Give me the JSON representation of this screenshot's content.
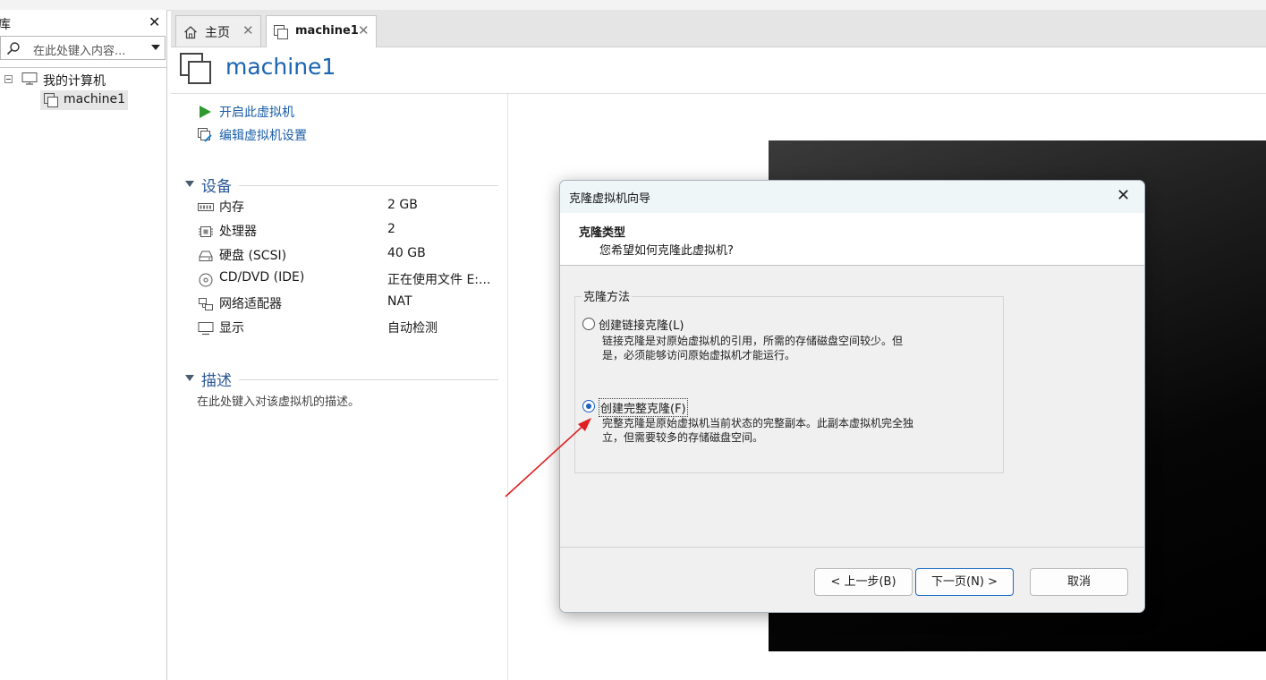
{
  "library": {
    "title": "库",
    "close": "✕",
    "search_placeholder": "在此处键入内容...",
    "tree": {
      "root_label": "我的计算机",
      "vm_label": "machine1"
    }
  },
  "tabs": [
    {
      "label": "主页",
      "close": "✕"
    },
    {
      "label": "machine1",
      "close": "✕"
    }
  ],
  "vm": {
    "title": "machine1",
    "actions": {
      "start": "开启此虚拟机",
      "edit": "编辑虚拟机设置"
    },
    "devices_title": "设备",
    "devices": [
      {
        "name": "内存",
        "value": "2 GB",
        "icon": "memory-icon"
      },
      {
        "name": "处理器",
        "value": "2",
        "icon": "cpu-icon"
      },
      {
        "name": "硬盘 (SCSI)",
        "value": "40 GB",
        "icon": "hard-disk-icon"
      },
      {
        "name": "CD/DVD (IDE)",
        "value": "正在使用文件 E:...",
        "icon": "cd-icon"
      },
      {
        "name": "网络适配器",
        "value": "NAT",
        "icon": "network-icon"
      },
      {
        "name": "显示",
        "value": "自动检测",
        "icon": "monitor-icon"
      }
    ],
    "desc_title": "描述",
    "desc_placeholder": "在此处键入对该虚拟机的描述。"
  },
  "dialog": {
    "title": "克隆虚拟机向导",
    "close": "✕",
    "header_title": "克隆类型",
    "header_subtitle": "您希望如何克隆此虚拟机?",
    "group_label": "克隆方法",
    "options": [
      {
        "label": "创建链接克隆(L)",
        "desc_line1": "链接克隆是对原始虚拟机的引用，所需的存储磁盘空间较少。但",
        "desc_line2": "是，必须能够访问原始虚拟机才能运行。",
        "selected": false
      },
      {
        "label": "创建完整克隆(F)",
        "desc_line1": "完整克隆是原始虚拟机当前状态的完整副本。此副本虚拟机完全独",
        "desc_line2": "立，但需要较多的存储磁盘空间。",
        "selected": true
      }
    ],
    "buttons": {
      "back": "< 上一步(B)",
      "next": "下一页(N) >",
      "cancel": "取消"
    }
  },
  "colors": {
    "accent": "#1a64b0",
    "selection": "#1a62c0",
    "annotation_arrow": "#e02020"
  }
}
